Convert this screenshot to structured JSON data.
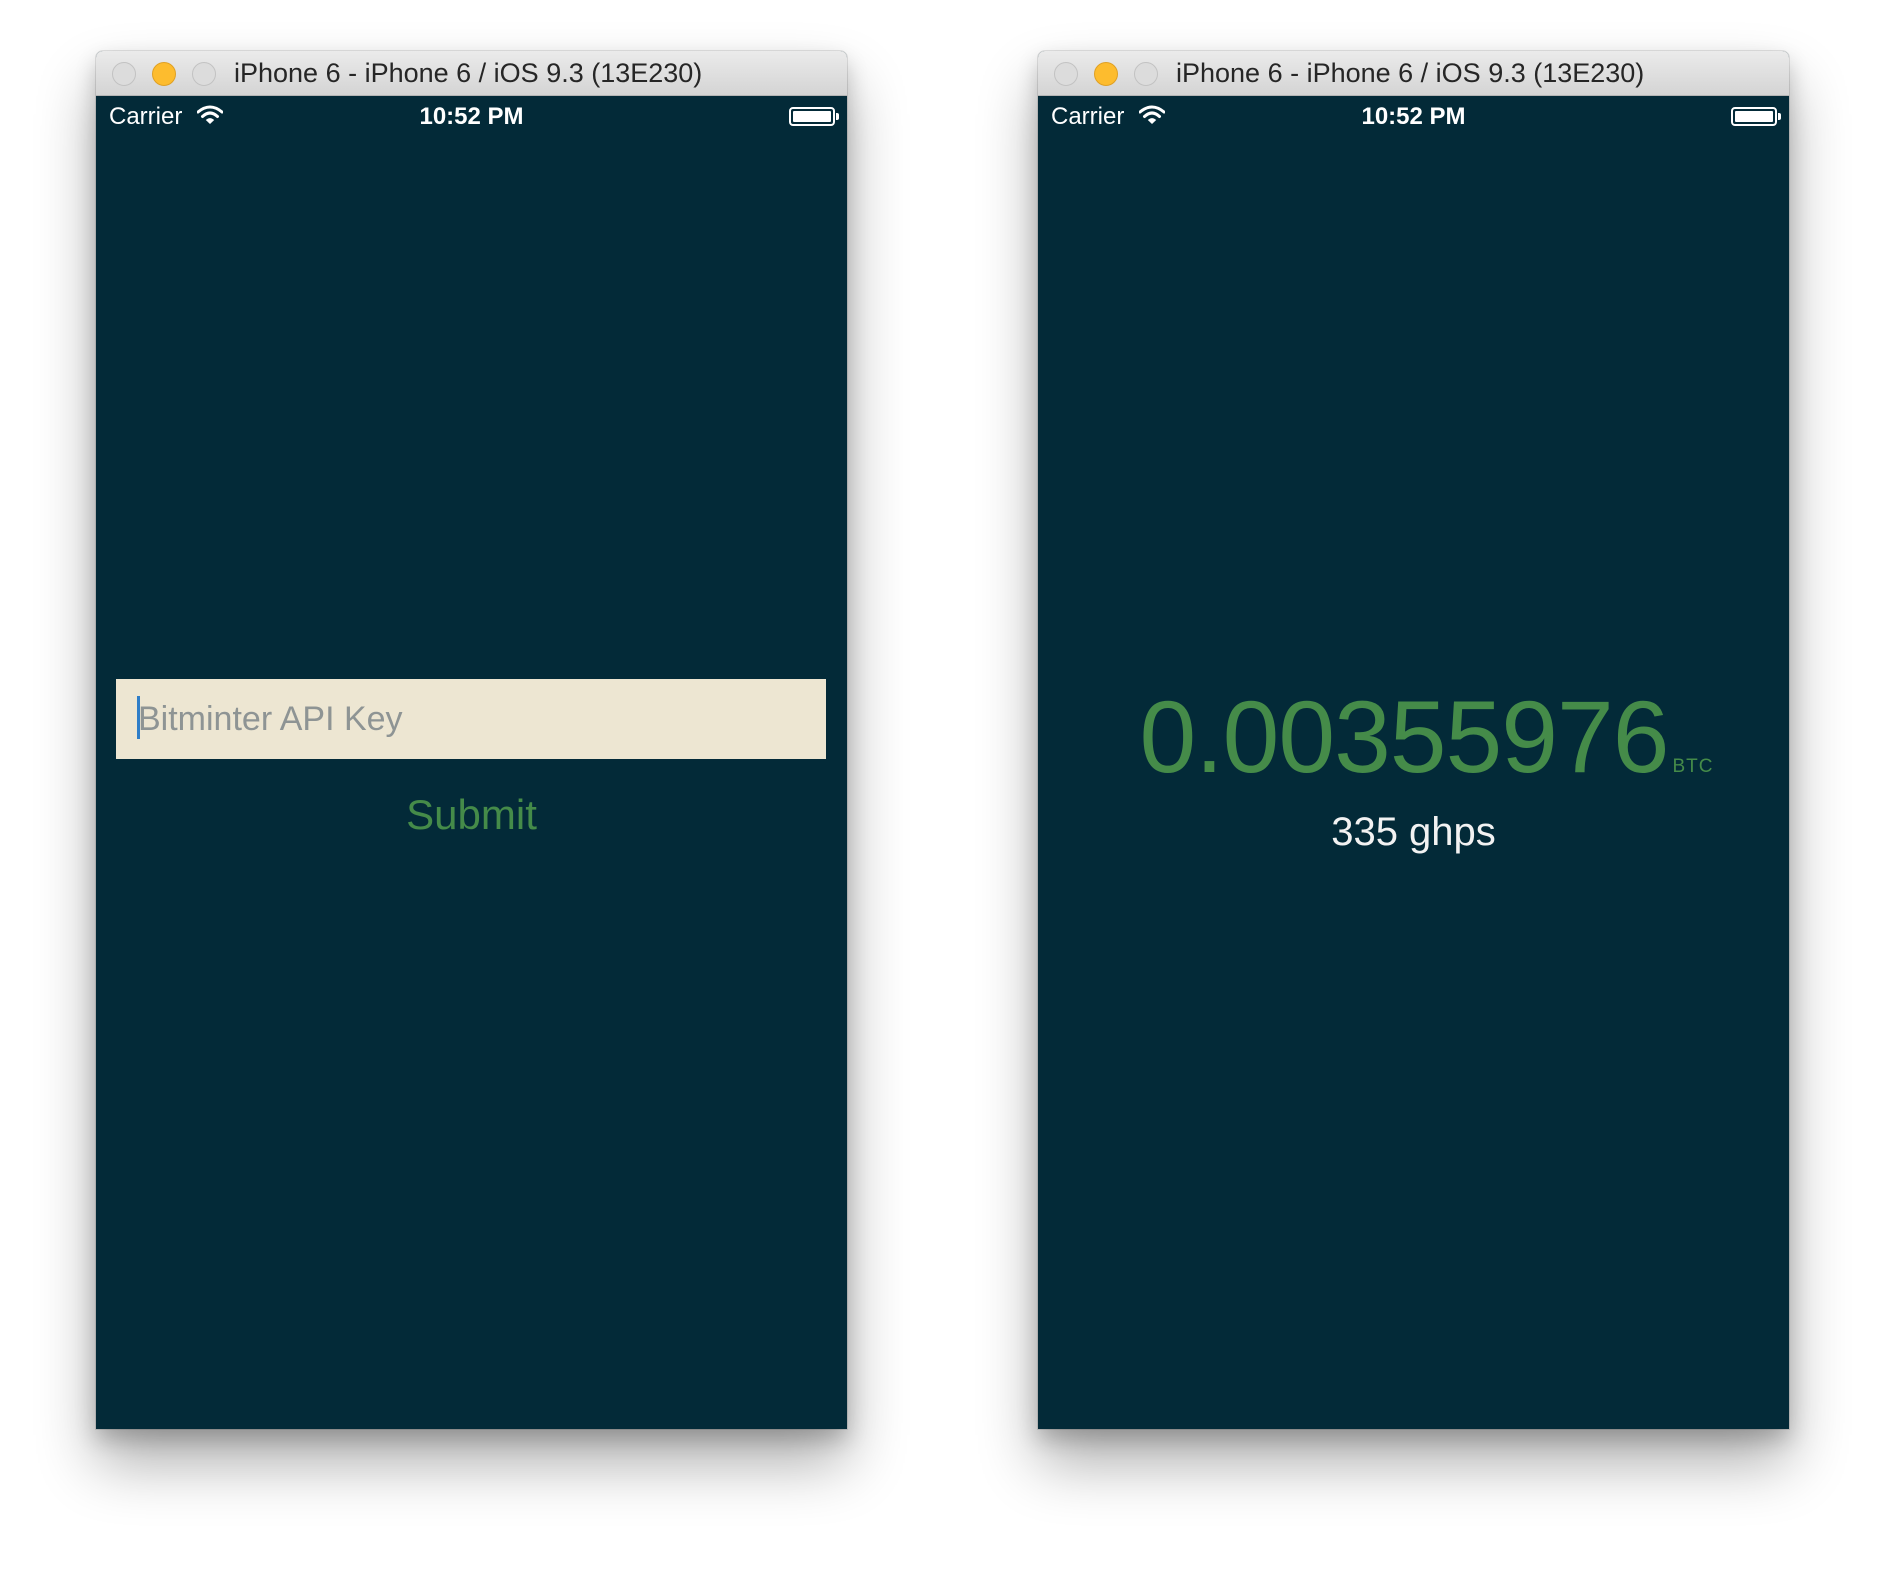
{
  "windows": [
    {
      "title": "iPhone 6 - iPhone 6 / iOS 9.3 (13E230)",
      "status_bar": {
        "carrier": "Carrier",
        "time": "10:52 PM"
      },
      "api_key_field": {
        "placeholder": "Bitminter API Key",
        "value": ""
      },
      "submit_label": "Submit"
    },
    {
      "title": "iPhone 6 - iPhone 6 / iOS 9.3 (13E230)",
      "status_bar": {
        "carrier": "Carrier",
        "time": "10:52 PM"
      },
      "balance": {
        "value": "0.00355976",
        "unit": "BTC"
      },
      "hashrate": "335 ghps"
    }
  ],
  "icons": {
    "traffic_lights": [
      "close-icon",
      "minimize-icon",
      "zoom-icon"
    ],
    "status": [
      "wifi-icon",
      "battery-icon"
    ]
  },
  "colors": {
    "background": "#032a38",
    "accent_green": "#458b49",
    "field_background": "#ede6d2",
    "minimize_yellow": "#fdbc2e",
    "cursor_blue": "#2f7ec8"
  }
}
